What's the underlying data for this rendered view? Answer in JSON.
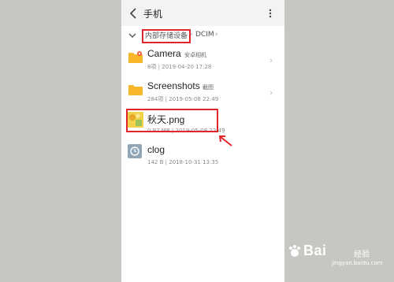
{
  "header": {
    "title": "手机"
  },
  "breadcrumb": {
    "root": "内部存储设备",
    "separator": "›",
    "current": "DCIM",
    "trail_arrow": "›"
  },
  "items": [
    {
      "name": "Camera",
      "tag": "安卓相机",
      "meta": "8项 | 2019-04-20 17:28",
      "icon": "folder-icon",
      "chevron": "›"
    },
    {
      "name": "Screenshots",
      "tag": "截图",
      "meta": "284项 | 2019-05-08 22:49",
      "icon": "folder-icon",
      "chevron": "›"
    },
    {
      "name": "秋天.png",
      "meta": "0.97 MB | 2019-05-08 22:49",
      "icon": "image-thumbnail-icon"
    },
    {
      "name": "clog",
      "meta": "142 B | 2018-10-31 13:35",
      "icon": "clog-file-icon"
    }
  ],
  "watermark": {
    "brand": "Bai",
    "brand2": "经验",
    "url": "jingyan.baidu.com"
  },
  "colors": {
    "accent_red": "#e0262b",
    "folder_yellow": "#f7b52b",
    "background": "#c8c6c2"
  }
}
